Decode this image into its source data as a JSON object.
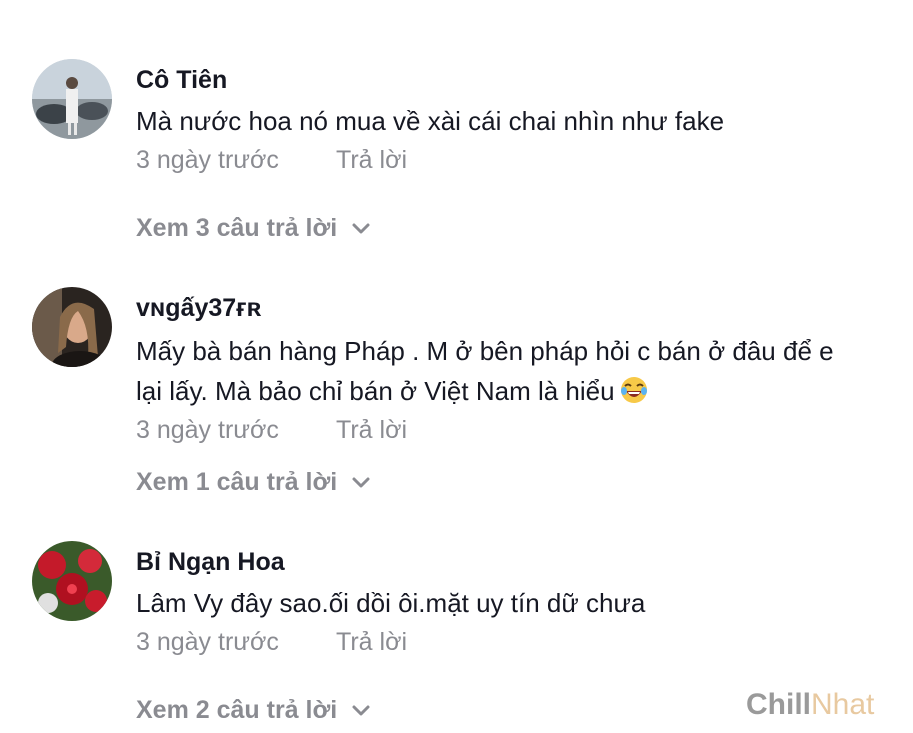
{
  "comments": [
    {
      "username": "Cô Tiên",
      "text_lines": [
        "Mà nước hoa nó mua về xài cái chai nhìn như fake"
      ],
      "time": "3 ngày trước",
      "reply_label": "Trả lời",
      "view_replies": "Xem 3 câu trả lời"
    },
    {
      "username": "ᴠɴgấy37ғʀ",
      "text_lines": [
        "Mấy bà bán hàng Pháp . M ở bên pháp hỏi c bán ở đâu để e",
        "lại lấy. Mà bảo chỉ bán ở Việt Nam là hiểu"
      ],
      "emoji": "joy-emoji-icon",
      "time": "3 ngày trước",
      "reply_label": "Trả lời",
      "view_replies": "Xem 1 câu trả lời"
    },
    {
      "username": "Bỉ Ngạn Hoa",
      "text_lines": [
        "Lâm Vy đây sao.ối dồi ôi.mặt uy tín dữ chưa"
      ],
      "time": "3 ngày trước",
      "reply_label": "Trả lời",
      "view_replies": "Xem 2 câu trả lời"
    }
  ],
  "watermark": {
    "part1": "Chill",
    "part2": "Nhat"
  },
  "colors": {
    "text": "#161823",
    "muted": "#8a8b91"
  }
}
